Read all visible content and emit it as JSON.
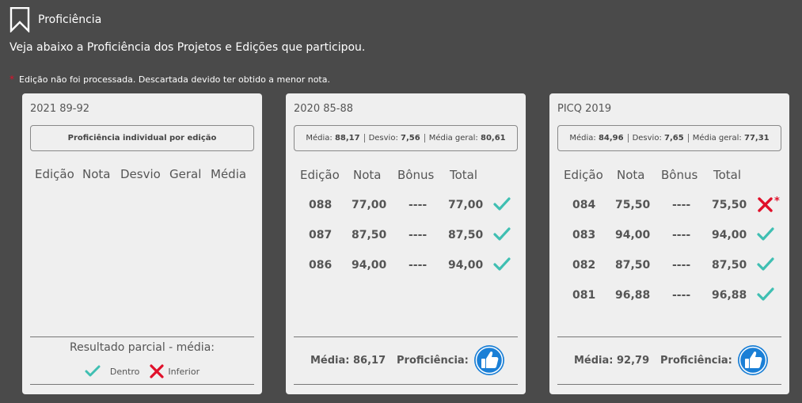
{
  "header": {
    "title": "Proficiência",
    "icon": "bookmark-icon"
  },
  "subtitle": "Veja abaixo a Proficiência dos Projetos e Edições que participou.",
  "note": {
    "star": "*",
    "text": "Edição não foi processada. Descartada devido ter obtido a menor nota."
  },
  "colors": {
    "check": "#3fbfb2",
    "cross": "#e0102a",
    "thumb": "#1a7fd6"
  },
  "cards": [
    {
      "title": "2021 89-92",
      "pill": "Proficiência individual por edição",
      "columns": [
        "Edição",
        "Nota",
        "Desvio",
        "Geral",
        "Média"
      ],
      "legend_title": "Resultado parcial - média:",
      "legend": {
        "inside": "Dentro",
        "inferior": "Inferior"
      }
    },
    {
      "title": "2020 85-88",
      "stats": {
        "media_label": "Média:",
        "media": "88,17",
        "desvio_label": "Desvio:",
        "desvio": "7,56",
        "geral_label": "Média geral:",
        "geral": "80,61"
      },
      "columns": [
        "Edição",
        "Nota",
        "Bônus",
        "Total"
      ],
      "rows": [
        {
          "edicao": "088",
          "nota": "77,00",
          "bonus": "----",
          "total": "77,00",
          "status": "check"
        },
        {
          "edicao": "087",
          "nota": "87,50",
          "bonus": "----",
          "total": "87,50",
          "status": "check"
        },
        {
          "edicao": "086",
          "nota": "94,00",
          "bonus": "----",
          "total": "94,00",
          "status": "check"
        }
      ],
      "footer": {
        "media": "Média: 86,17",
        "prof_label": "Proficiência:",
        "prof_icon": "thumbs-up-icon"
      }
    },
    {
      "title": "PICQ 2019",
      "stats": {
        "media_label": "Média:",
        "media": "84,96",
        "desvio_label": "Desvio:",
        "desvio": "7,65",
        "geral_label": "Média geral:",
        "geral": "77,31"
      },
      "columns": [
        "Edição",
        "Nota",
        "Bônus",
        "Total"
      ],
      "rows": [
        {
          "edicao": "084",
          "nota": "75,50",
          "bonus": "----",
          "total": "75,50",
          "status": "cross",
          "star": "*"
        },
        {
          "edicao": "083",
          "nota": "94,00",
          "bonus": "----",
          "total": "94,00",
          "status": "check"
        },
        {
          "edicao": "082",
          "nota": "87,50",
          "bonus": "----",
          "total": "87,50",
          "status": "check"
        },
        {
          "edicao": "081",
          "nota": "96,88",
          "bonus": "----",
          "total": "96,88",
          "status": "check"
        }
      ],
      "footer": {
        "media": "Média: 92,79",
        "prof_label": "Proficiência:",
        "prof_icon": "thumbs-up-icon"
      }
    }
  ]
}
